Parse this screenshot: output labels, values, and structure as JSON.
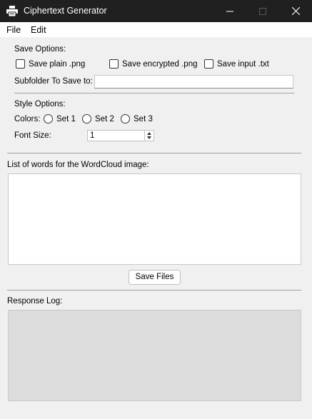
{
  "window": {
    "title": "Ciphertext Generator",
    "app_icon": "printer-icon",
    "minimize_icon": "minimize-icon",
    "maximize_icon": "maximize-icon",
    "close_icon": "close-icon"
  },
  "menu": {
    "file": "File",
    "edit": "Edit"
  },
  "save_options": {
    "heading": "Save Options:",
    "save_plain": "Save plain .png",
    "save_encrypted": "Save encrypted .png",
    "save_input": "Save input .txt",
    "subfolder_label": "Subfolder To Save to:",
    "subfolder_value": ""
  },
  "style_options": {
    "heading": "Style Options:",
    "colors_label": "Colors:",
    "set1": "Set 1",
    "set2": "Set 2",
    "set3": "Set 3",
    "font_size_label": "Font Size:",
    "font_size_value": "1"
  },
  "wordlist": {
    "label": "List of words for the WordCloud image:",
    "value": ""
  },
  "save_button": "Save Files",
  "log": {
    "label": "Response Log:",
    "value": ""
  },
  "colors": {
    "titlebar_bg": "#202020",
    "window_bg": "#f0f0f0",
    "log_bg": "#dcdcdc"
  }
}
